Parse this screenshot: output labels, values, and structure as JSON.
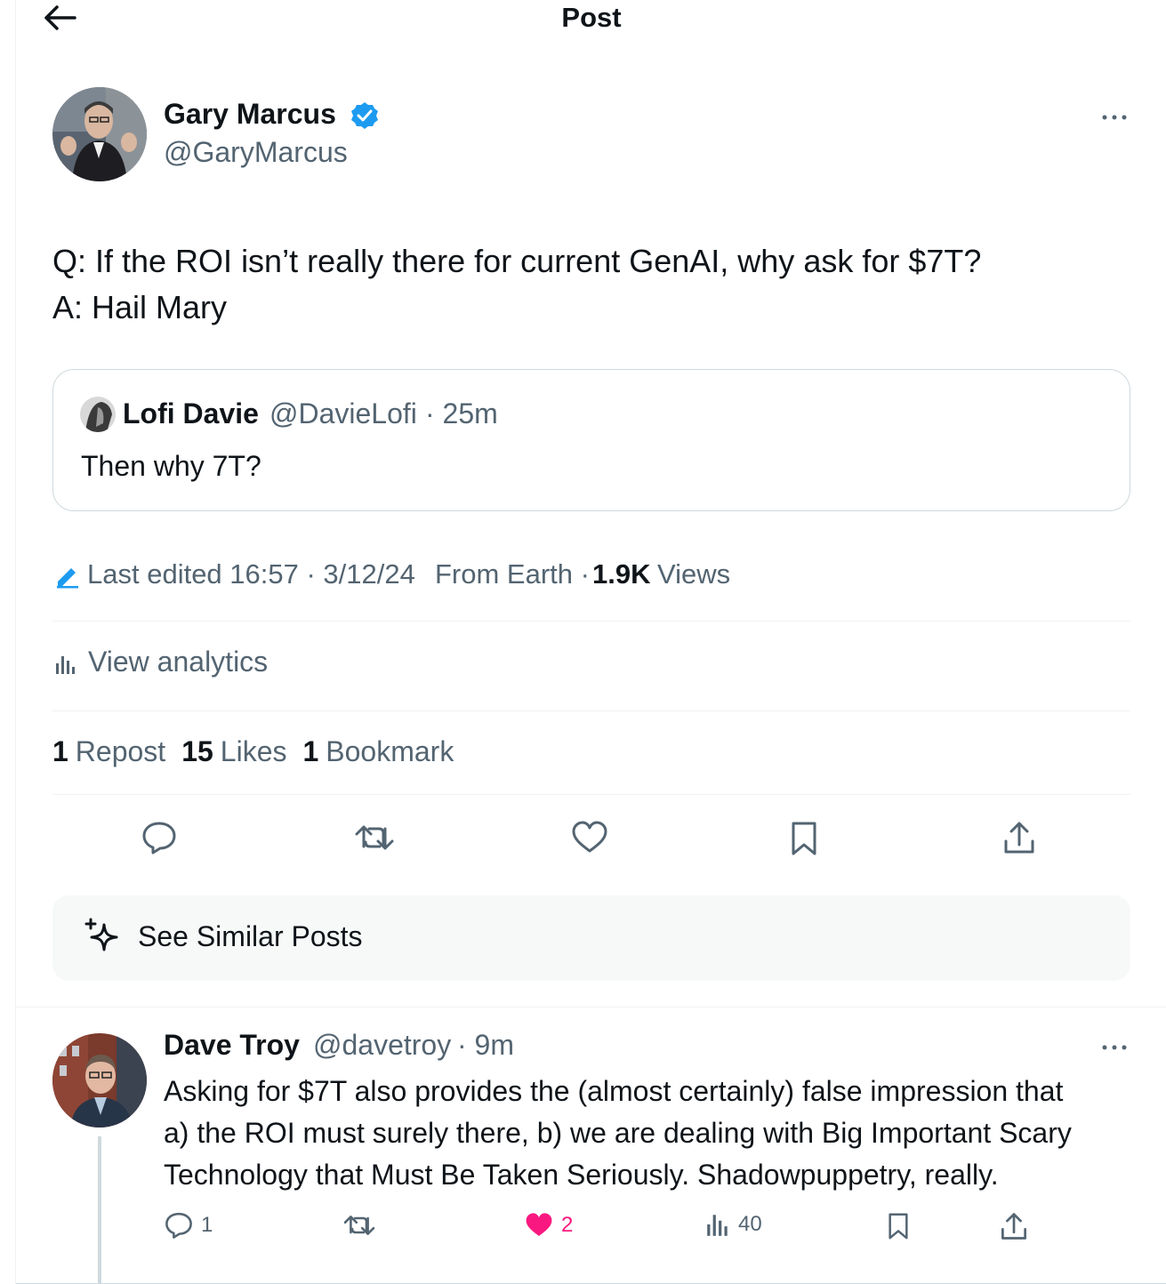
{
  "header": {
    "title": "Post"
  },
  "post": {
    "author_name": "Gary Marcus",
    "author_handle": "@GaryMarcus",
    "text_line1": "Q: If the ROI isn’t really there for current GenAI, why ask for $7T?",
    "text_line2": "A: Hail Mary",
    "quote": {
      "author_name": "Lofi Davie",
      "author_handle": "@DavieLofi",
      "time": "· 25m",
      "text": "Then why 7T?"
    },
    "meta": {
      "edited": "Last edited 16:57 · 3/12/24",
      "source": "From Earth ·",
      "views_count": "1.9K",
      "views_label": "Views"
    },
    "analytics_label": "View analytics",
    "stats": {
      "reposts_count": "1",
      "reposts_label": "Repost",
      "likes_count": "15",
      "likes_label": "Likes",
      "bookmarks_count": "1",
      "bookmarks_label": "Bookmark"
    },
    "similar_label": "See Similar Posts"
  },
  "reply": {
    "author_name": "Dave Troy",
    "author_handle": "@davetroy",
    "time": "· 9m",
    "text_line1": "Asking for $7T also provides the (almost certainly) false impression that",
    "text_line2": "a) the ROI must surely there, b) we are dealing with Big Important Scary",
    "text_line3": "Technology that Must Be Taken Seriously. Shadowpuppetry, really.",
    "replies": "1",
    "likes": "2",
    "views": "40"
  },
  "colors": {
    "verified": "#1d9bf0",
    "like_active": "#f91880",
    "muted": "#536471",
    "text": "#0f1419"
  },
  "icons": [
    "back-arrow-icon",
    "verified-badge-icon",
    "more-icon",
    "edit-pencil-icon",
    "analytics-icon",
    "reply-icon",
    "repost-icon",
    "like-icon",
    "bookmark-icon",
    "share-icon",
    "sparkle-icon"
  ]
}
